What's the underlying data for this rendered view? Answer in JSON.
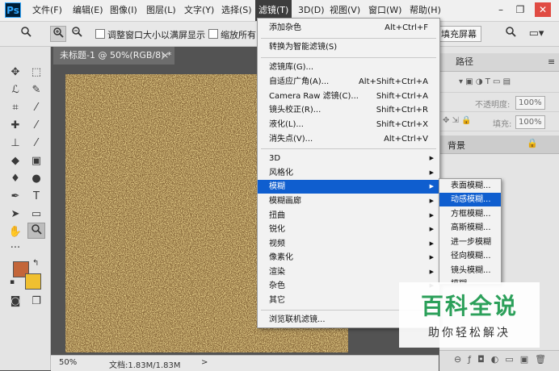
{
  "app": {
    "logo": "Ps"
  },
  "menubar": {
    "items": [
      "文件(F)",
      "编辑(E)",
      "图像(I)",
      "图层(L)",
      "文字(Y)",
      "选择(S)",
      "滤镜(T)",
      "3D(D)",
      "视图(V)",
      "窗口(W)",
      "帮助(H)"
    ],
    "active": "滤镜(T)"
  },
  "window_controls": {
    "minimize": "–",
    "restore": "❐",
    "close": "✕"
  },
  "options_bar": {
    "resize_windows_label": "调整窗口大小以满屏显示",
    "zoom_all_label": "缩放所有",
    "fill_screen_button": "填充屏幕"
  },
  "document": {
    "tab_title": "未标题-1 @ 50%(RGB/8) *",
    "tab_close": "×",
    "zoom": "50%",
    "doc_info": "文档:1.83M/1.83M",
    "status_arrow": ">"
  },
  "right_panel": {
    "tab_paths": "路径",
    "opacity_label": "不透明度:",
    "opacity_value": "100%",
    "fill_label": "填充:",
    "fill_value": "100%",
    "layer_name": "背景"
  },
  "filter_menu": {
    "items": [
      {
        "label": "添加杂色",
        "shortcut": "Alt+Ctrl+F"
      },
      {
        "label": "转换为智能滤镜(S)",
        "shortcut": ""
      },
      {
        "label": "滤镜库(G)...",
        "shortcut": ""
      },
      {
        "label": "自适应广角(A)...",
        "shortcut": "Alt+Shift+Ctrl+A"
      },
      {
        "label": "Camera Raw 滤镜(C)...",
        "shortcut": "Shift+Ctrl+A"
      },
      {
        "label": "镜头校正(R)...",
        "shortcut": "Shift+Ctrl+R"
      },
      {
        "label": "液化(L)...",
        "shortcut": "Shift+Ctrl+X"
      },
      {
        "label": "消失点(V)...",
        "shortcut": "Alt+Ctrl+V"
      },
      {
        "label": "3D",
        "submenu": true
      },
      {
        "label": "风格化",
        "submenu": true
      },
      {
        "label": "模糊",
        "submenu": true,
        "highlighted": true
      },
      {
        "label": "模糊画廊",
        "submenu": true
      },
      {
        "label": "扭曲",
        "submenu": true
      },
      {
        "label": "锐化",
        "submenu": true
      },
      {
        "label": "视频",
        "submenu": true
      },
      {
        "label": "像素化",
        "submenu": true
      },
      {
        "label": "渲染",
        "submenu": true
      },
      {
        "label": "杂色",
        "submenu": true
      },
      {
        "label": "其它",
        "submenu": true
      },
      {
        "label": "浏览联机滤镜...",
        "shortcut": ""
      }
    ]
  },
  "blur_submenu": {
    "items": [
      "表面模糊...",
      "动感模糊...",
      "方框模糊...",
      "高斯模糊...",
      "进一步模糊",
      "径向模糊...",
      "镜头模糊...",
      "模糊"
    ],
    "highlighted": "动感模糊..."
  },
  "watermark": {
    "title": "百科全说",
    "subtitle": "助你轻松解决"
  },
  "colors": {
    "foreground": "#c3663a",
    "background": "#f0c030",
    "menu_highlight": "#0f5ecf",
    "watermark_green": "#2ca05a"
  }
}
